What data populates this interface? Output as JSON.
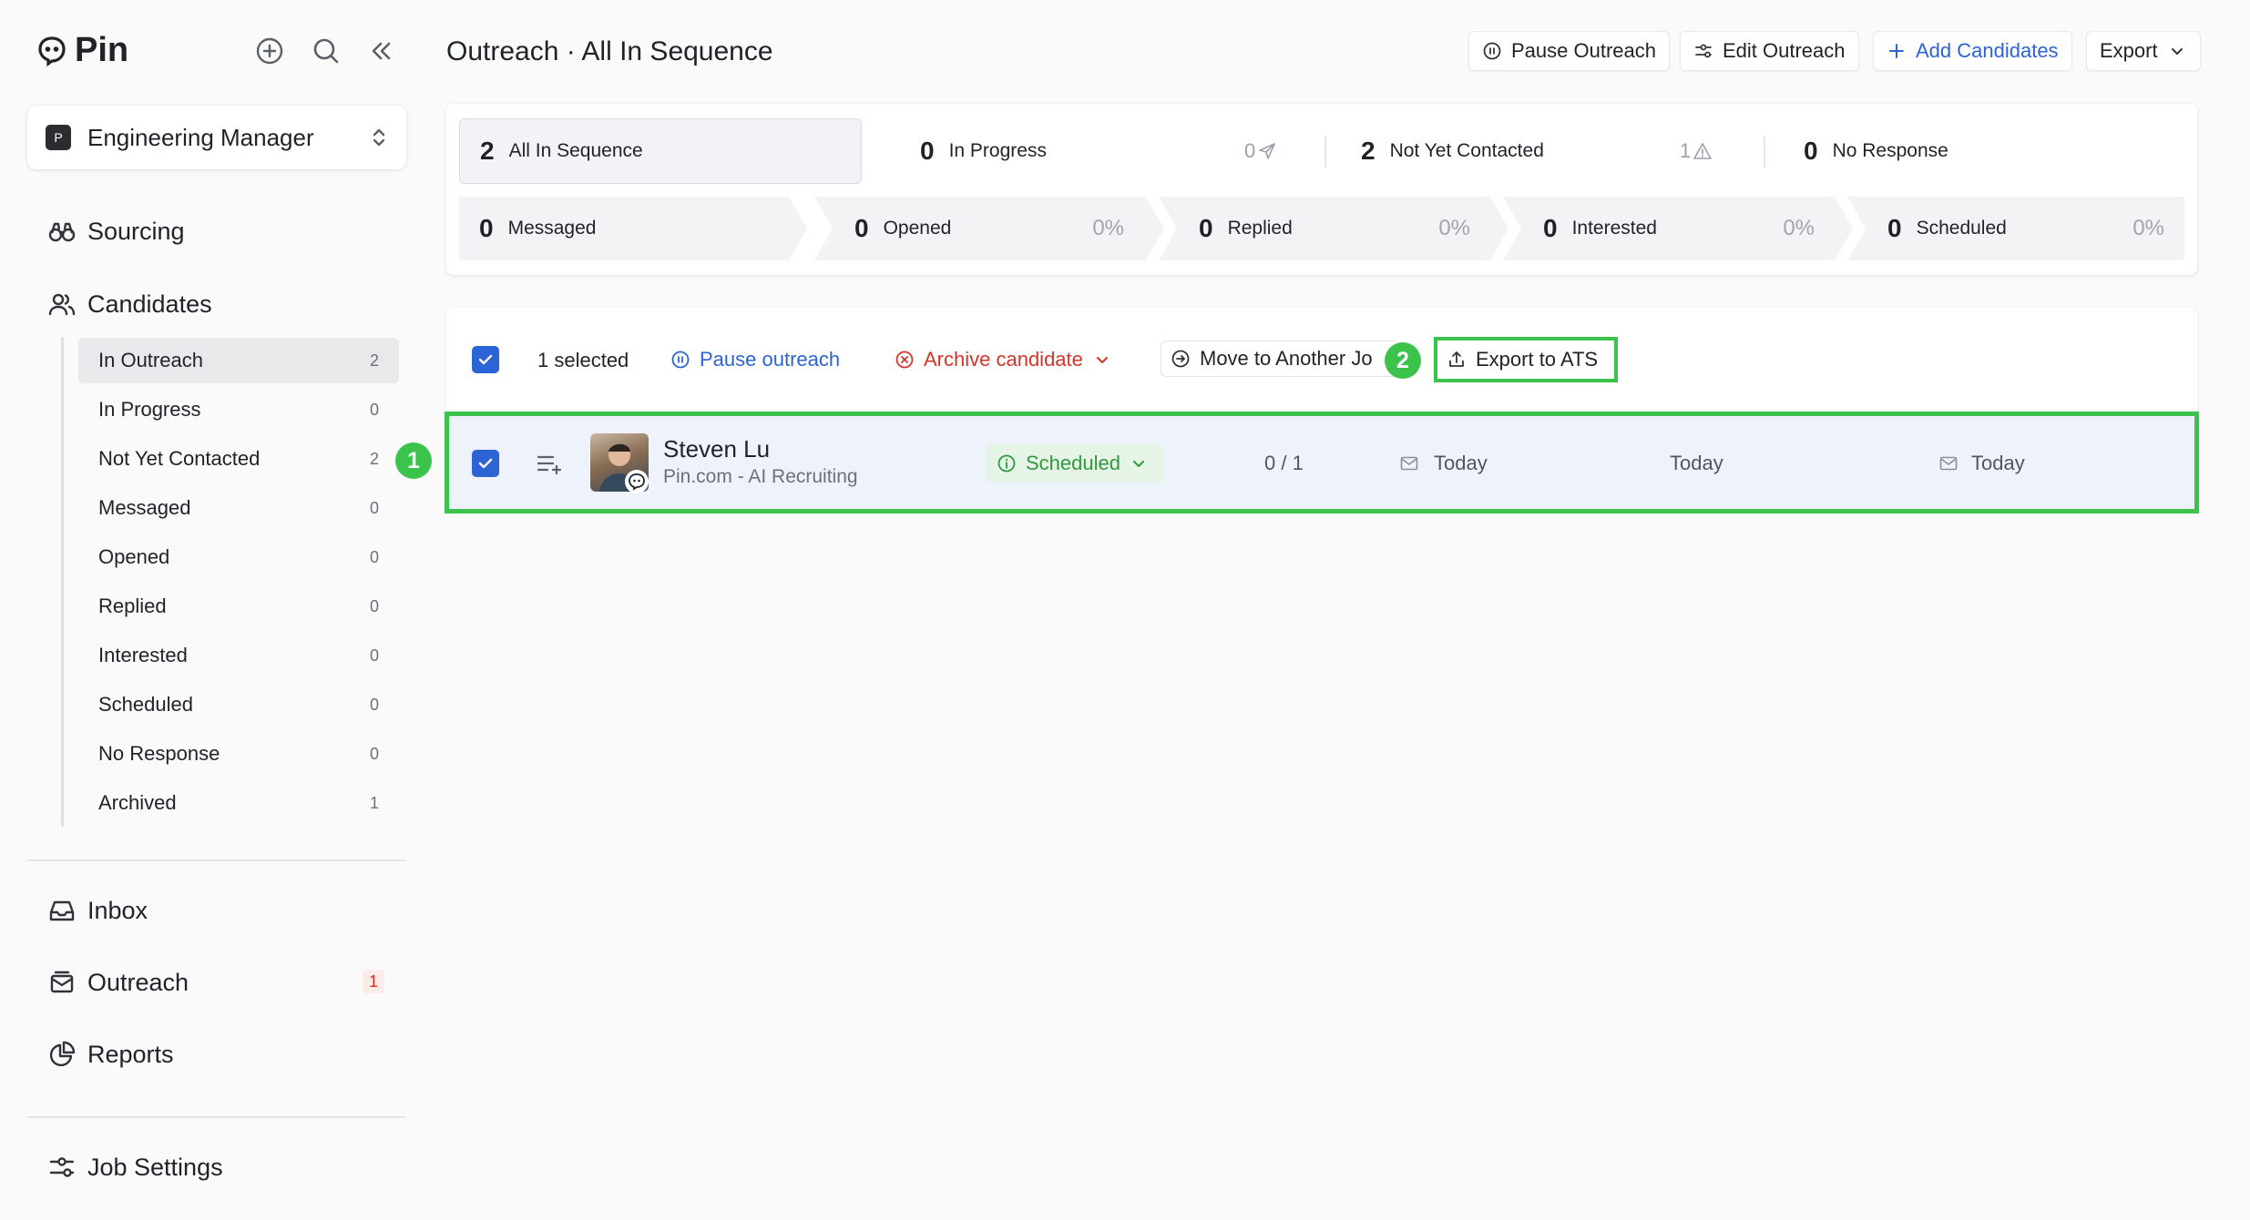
{
  "brand": {
    "name": "Pin"
  },
  "sidebar": {
    "job_selector": {
      "badge": "P",
      "label": "Engineering Manager"
    },
    "nav": {
      "sourcing": "Sourcing",
      "candidates": "Candidates",
      "inbox": "Inbox",
      "outreach": "Outreach",
      "outreach_badge": "1",
      "reports": "Reports",
      "job_settings": "Job Settings"
    },
    "candidate_filters": [
      {
        "label": "In Outreach",
        "count": "2"
      },
      {
        "label": "In Progress",
        "count": "0"
      },
      {
        "label": "Not Yet Contacted",
        "count": "2"
      },
      {
        "label": "Messaged",
        "count": "0"
      },
      {
        "label": "Opened",
        "count": "0"
      },
      {
        "label": "Replied",
        "count": "0"
      },
      {
        "label": "Interested",
        "count": "0"
      },
      {
        "label": "Scheduled",
        "count": "0"
      },
      {
        "label": "No Response",
        "count": "0"
      },
      {
        "label": "Archived",
        "count": "1"
      }
    ]
  },
  "header": {
    "title": "Outreach · All In Sequence",
    "buttons": {
      "pause": "Pause Outreach",
      "edit": "Edit Outreach",
      "add": "Add Candidates",
      "export": "Export"
    }
  },
  "stats": {
    "top": [
      {
        "num": "2",
        "label": "All In Sequence"
      },
      {
        "num": "0",
        "label": "In Progress",
        "side": "0"
      },
      {
        "num": "2",
        "label": "Not Yet Contacted",
        "side": "1"
      },
      {
        "num": "0",
        "label": "No Response"
      }
    ],
    "funnel": [
      {
        "num": "0",
        "label": "Messaged",
        "pct": ""
      },
      {
        "num": "0",
        "label": "Opened",
        "pct": "0%"
      },
      {
        "num": "0",
        "label": "Replied",
        "pct": "0%"
      },
      {
        "num": "0",
        "label": "Interested",
        "pct": "0%"
      },
      {
        "num": "0",
        "label": "Scheduled",
        "pct": "0%"
      }
    ]
  },
  "bulk_bar": {
    "selected": "1 selected",
    "pause": "Pause outreach",
    "archive": "Archive candidate",
    "move": "Move to Another Jo",
    "export_ats": "Export to ATS"
  },
  "steps": {
    "one": "1",
    "two": "2"
  },
  "candidate": {
    "name": "Steven Lu",
    "company": "Pin.com - AI Recruiting",
    "status": "Scheduled",
    "progress": "0 / 1",
    "col_a": "Today",
    "col_b": "Today",
    "col_c": "Today"
  },
  "colors": {
    "accent": "#2c64d6",
    "highlight": "#3bc34b",
    "danger": "#d6332a"
  }
}
